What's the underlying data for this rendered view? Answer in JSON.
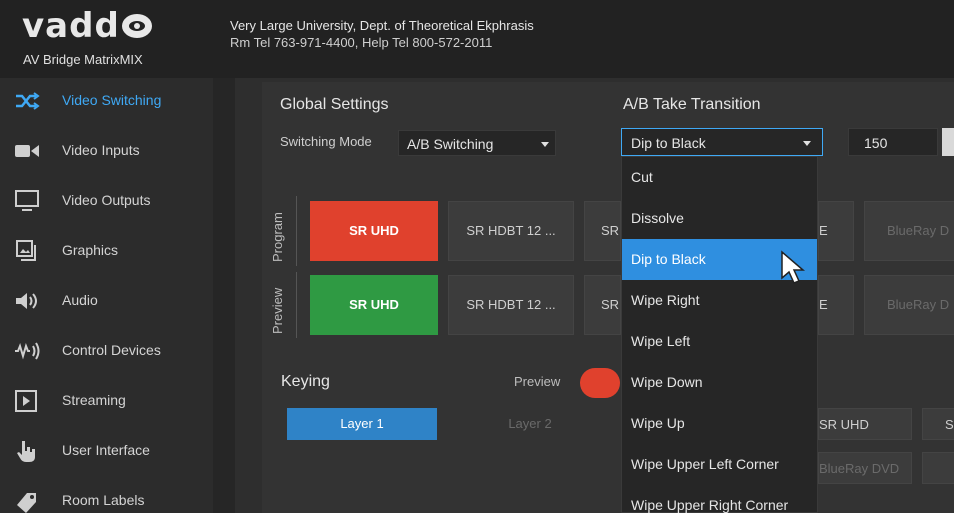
{
  "header": {
    "logo_text": "vadd",
    "product": "AV Bridge MatrixMIX",
    "org_line1": "Very Large University, Dept. of Theoretical Ekphrasis",
    "org_line2": "Rm Tel 763-971-4400, Help Tel 800-572-2011"
  },
  "sidebar": {
    "items": [
      {
        "label": "Video Switching",
        "icon": "shuffle-icon",
        "active": true
      },
      {
        "label": "Video Inputs",
        "icon": "camera-icon",
        "active": false
      },
      {
        "label": "Video Outputs",
        "icon": "monitor-icon",
        "active": false
      },
      {
        "label": "Graphics",
        "icon": "graphics-icon",
        "active": false
      },
      {
        "label": "Audio",
        "icon": "speaker-icon",
        "active": false
      },
      {
        "label": "Control Devices",
        "icon": "control-signal-icon",
        "active": false
      },
      {
        "label": "Streaming",
        "icon": "play-icon",
        "active": false
      },
      {
        "label": "User Interface",
        "icon": "touch-hand-icon",
        "active": false
      },
      {
        "label": "Room Labels",
        "icon": "label-icon",
        "active": false
      }
    ]
  },
  "global_settings": {
    "title": "Global Settings",
    "switching_mode_label": "Switching Mode",
    "switching_mode_value": "A/B Switching"
  },
  "transition": {
    "title": "A/B Take Transition",
    "selected": "Dip to Black",
    "duration": "150",
    "options": [
      "Cut",
      "Dissolve",
      "Dip to Black",
      "Wipe Right",
      "Wipe Left",
      "Wipe Down",
      "Wipe Up",
      "Wipe Upper Left Corner",
      "Wipe Upper Right Corner"
    ]
  },
  "program": {
    "label": "Program",
    "buttons": [
      "SR UHD",
      "SR HDBT 12 ...",
      "SR",
      "E",
      "BlueRay D"
    ]
  },
  "preview": {
    "label": "Preview",
    "buttons": [
      "SR UHD",
      "SR HDBT 12 ...",
      "SR",
      "E",
      "BlueRay D"
    ]
  },
  "keying": {
    "title": "Keying",
    "preview_label": "Preview",
    "layer1": "Layer 1",
    "layer2": "Layer 2",
    "sources": [
      "SR UHD",
      "SI",
      "BlueRay DVD"
    ]
  },
  "colors": {
    "accent": "#3fa9f5",
    "program_red": "#e0412d",
    "preview_green": "#2f9a43",
    "selected_blue": "#2f8fe0"
  }
}
